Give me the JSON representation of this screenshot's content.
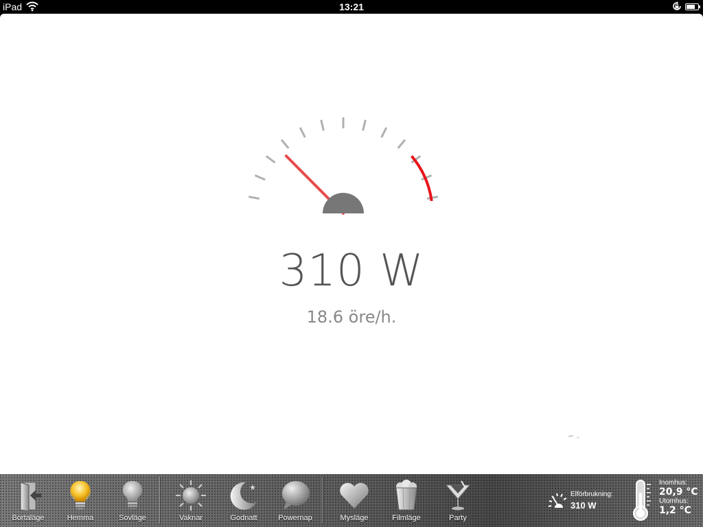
{
  "statusbar": {
    "device": "iPad",
    "time": "13:21"
  },
  "gauge": {
    "power": "310 W",
    "cost": "18.6 öre/h.",
    "needle_fraction": 0.22,
    "colors": {
      "needle": "#e84a4a",
      "redzone": "#e8141c",
      "ticks": "#b0b0b0",
      "hub": "#777777"
    }
  },
  "scenes": [
    {
      "id": "bortalage",
      "label": "Bortaläge",
      "icon": "door-exit-icon"
    },
    {
      "id": "hemma",
      "label": "Hemma",
      "icon": "lightbulb-on-icon",
      "active": true
    },
    {
      "id": "sovlage",
      "label": "Sovläge",
      "icon": "lightbulb-off-icon"
    },
    {
      "id": "vaknar",
      "label": "Vaknar",
      "icon": "sun-icon"
    },
    {
      "id": "godnatt",
      "label": "Godnatt",
      "icon": "moon-icon"
    },
    {
      "id": "powernap",
      "label": "Powernap",
      "icon": "speech-bubble-icon"
    },
    {
      "id": "myslage",
      "label": "Mysläge",
      "icon": "heart-icon"
    },
    {
      "id": "filmlage",
      "label": "Filmläge",
      "icon": "popcorn-icon"
    },
    {
      "id": "party",
      "label": "Party",
      "icon": "cocktail-icon"
    }
  ],
  "power_readout": {
    "label": "Elförbrukning:",
    "value": "310 W"
  },
  "temperature": {
    "indoor_label": "Inomhus:",
    "indoor_value": "20,9 °C",
    "outdoor_label": "Utomhus:",
    "outdoor_value": "1,2 °C"
  }
}
